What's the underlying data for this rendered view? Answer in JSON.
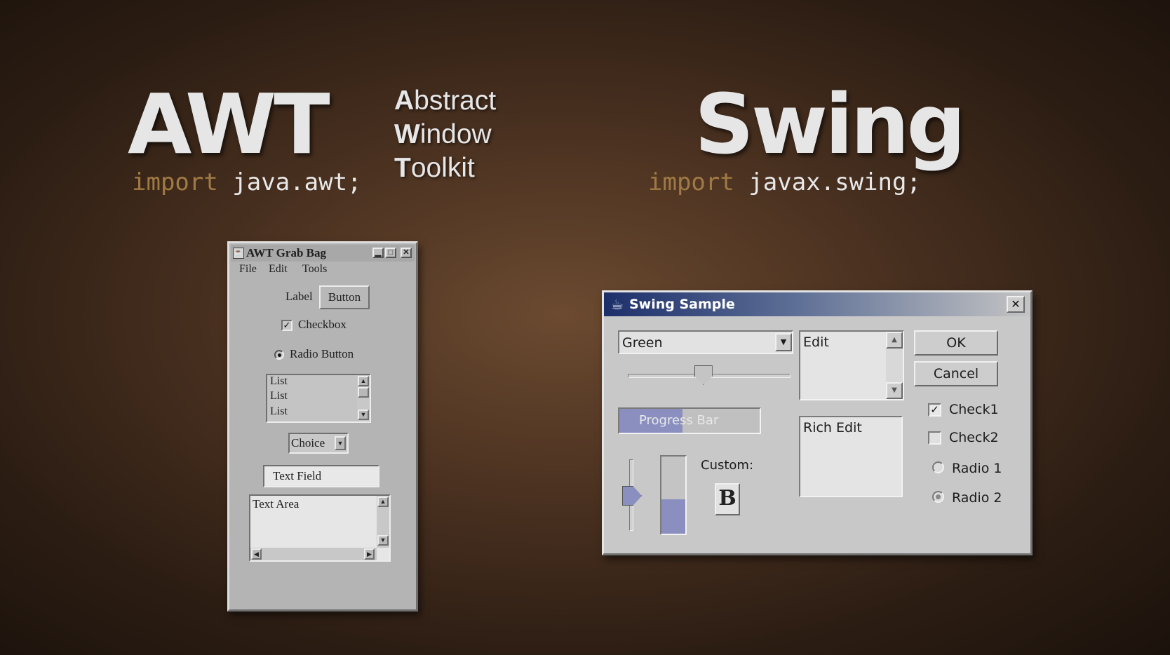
{
  "awt_heading": {
    "title": "AWT",
    "import_keyword": "import",
    "import_package": " java.awt;",
    "acronym": [
      {
        "initial": "A",
        "rest": "bstract"
      },
      {
        "initial": "W",
        "rest": "indow"
      },
      {
        "initial": "T",
        "rest": "oolkit"
      }
    ]
  },
  "swing_heading": {
    "title": "Swing",
    "import_keyword": "import",
    "import_package": " javax.swing;"
  },
  "awt_window": {
    "title": "AWT Grab Bag",
    "title_buttons": [
      "minimize-icon",
      "maximize-icon",
      "close-icon"
    ],
    "menu": [
      "File",
      "Edit",
      "Tools"
    ],
    "label": "Label",
    "button": "Button",
    "checkbox": {
      "label": "Checkbox",
      "checked": true
    },
    "radio": {
      "label": "Radio Button",
      "selected": true
    },
    "list_items": [
      "List",
      "List",
      "List"
    ],
    "choice": "Choice",
    "text_field": "Text Field",
    "text_area": "Text Area"
  },
  "swing_window": {
    "title": "Swing Sample",
    "combo_value": "Green",
    "slider_value": 0.46,
    "progress_bar": {
      "label": "Progress Bar",
      "value": 0.45
    },
    "vertical_slider_value": 0.5,
    "vertical_progress_value": 0.45,
    "custom_label": "Custom:",
    "custom_icon": "bold-B-icon",
    "edit_text": "Edit",
    "rich_edit_text": "Rich Edit",
    "ok_button": "OK",
    "cancel_button": "Cancel",
    "check1": {
      "label": "Check1",
      "checked": true
    },
    "check2": {
      "label": "Check2",
      "checked": false
    },
    "radio1": {
      "label": "Radio 1",
      "selected": false
    },
    "radio2": {
      "label": "Radio 2",
      "selected": true
    },
    "accent_color": "#8a8fc0",
    "title_gradient_start": "#1c2f6a"
  }
}
